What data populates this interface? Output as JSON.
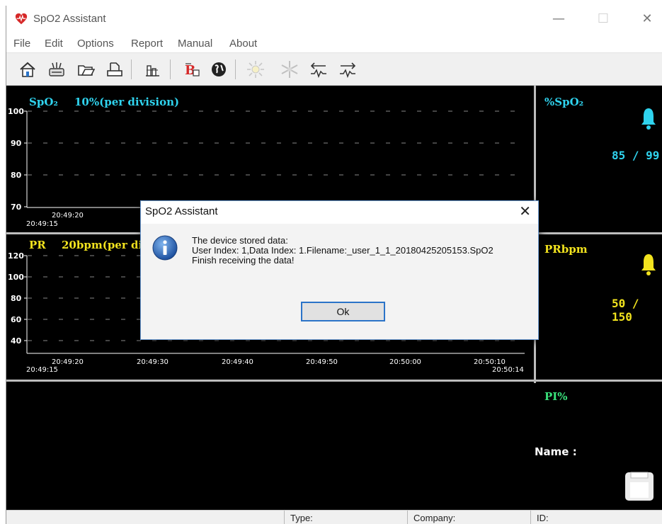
{
  "window": {
    "title": "SpO2 Assistant",
    "minimize_glyph": "—",
    "maximize_glyph": "☐",
    "close_glyph": "✕"
  },
  "menu": {
    "file": "File",
    "edit": "Edit",
    "options": "Options",
    "report": "Report",
    "manual": "Manual",
    "about": "About"
  },
  "toolbar": {
    "icons": [
      "home-icon",
      "device-icon",
      "open-folder-icon",
      "print-icon",
      "chart-icon",
      "user-icon",
      "globe-icon",
      "sun-icon",
      "snowflake-icon",
      "download-wave-icon",
      "upload-wave-icon"
    ]
  },
  "spo2_panel": {
    "title": "SpO₂",
    "scale": "10%(per division)",
    "y_labels": [
      "100",
      "90",
      "80",
      "70"
    ],
    "time_left": "20:49:15",
    "time_first": "20:49:20",
    "readout_label": "%SpO₂",
    "readout_value": "85 / 99"
  },
  "pr_panel": {
    "title": "PR",
    "scale": "20bpm(per di",
    "y_labels": [
      "120",
      "100",
      "80",
      "60",
      "40"
    ],
    "time_left": "20:49:15",
    "time_ticks": [
      "20:49:20",
      "20:49:30",
      "20:49:40",
      "20:49:50",
      "20:50:00",
      "20:50:10"
    ],
    "time_right": "20:50:14",
    "readout_label": "PRbpm",
    "readout_value": "50 / 150"
  },
  "pi_panel": {
    "readout_label": "PI%",
    "name_label": "Name :"
  },
  "status": {
    "type": "Type:",
    "company": "Company:",
    "id": "ID:"
  },
  "dialog": {
    "title": "SpO2 Assistant",
    "close_glyph": "✕",
    "line1": "The device stored data:",
    "line2": "User Index: 1,Data Index: 1.Filename:_user_1_1_20180425205153.SpO2",
    "line3": "Finish receiving the data!",
    "ok_label": "Ok"
  },
  "colors": {
    "spo2": "#2fd3ee",
    "pr": "#f2e31e",
    "pi": "#39e07a",
    "accent": "#2b74c8"
  }
}
